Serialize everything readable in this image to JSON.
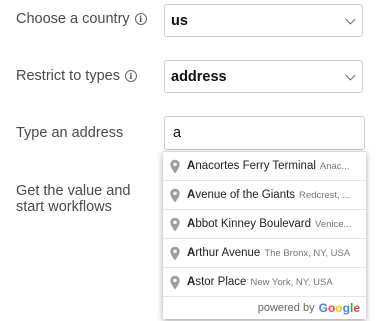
{
  "form": {
    "country": {
      "label": "Choose a country",
      "value": "us"
    },
    "types": {
      "label": "Restrict to types",
      "value": "address"
    },
    "address": {
      "label": "Type an address",
      "value": "a"
    },
    "workflow": {
      "label_line1": "Get the value and",
      "label_line2": "start workflows"
    }
  },
  "suggestions": [
    {
      "match": "A",
      "rest": "nacortes Ferry Terminal",
      "secondary": "Anac..."
    },
    {
      "match": "A",
      "rest": "venue of the Giants",
      "secondary": "Redcrest, ..."
    },
    {
      "match": "A",
      "rest": "bbot Kinney Boulevard",
      "secondary": "Venice..."
    },
    {
      "match": "A",
      "rest": "rthur Avenue",
      "secondary": "The Bronx, NY, USA"
    },
    {
      "match": "A",
      "rest": "stor Place",
      "secondary": "New York, NY, USA"
    }
  ],
  "powered_by": {
    "text": "powered by",
    "logo_text": "Google"
  },
  "icons": {
    "info": "info-icon",
    "chevron": "chevron-down-icon",
    "pin": "map-pin-icon"
  },
  "colors": {
    "google_blue": "#4285f4",
    "google_red": "#ea4335",
    "google_yellow": "#fbbc05",
    "google_green": "#34a853"
  }
}
